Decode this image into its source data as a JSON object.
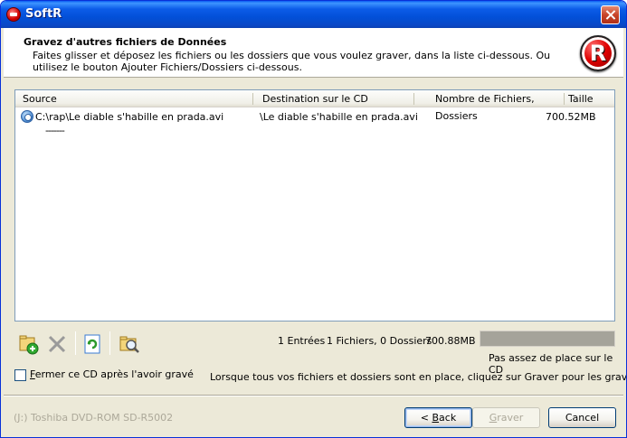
{
  "window": {
    "title": "SoftR"
  },
  "header": {
    "title": "Gravez d'autres fichiers de Données",
    "description": "Faites glisser et déposez les fichiers ou les dossiers que vous voulez graver, dans la liste ci-dessous. Ou utilisez le bouton Ajouter Fichiers/Dossiers ci-dessous.",
    "logo_letter": "R"
  },
  "list": {
    "columns": [
      "Source",
      "Destination sur le CD",
      "Nombre de Fichiers, Dossiers",
      "Taille"
    ],
    "rows": [
      {
        "source": "C:\\rap\\Le diable s'habille en prada.avi",
        "destination": "\\Le diable s'habille en prada.avi",
        "count": "",
        "size": "700.52MB"
      }
    ],
    "dash_row": "-------"
  },
  "toolbar": {
    "icons": [
      "add-files-icon",
      "delete-icon",
      "refresh-icon",
      "search-folder-icon"
    ]
  },
  "stats": {
    "entries": "1 Entrées",
    "files_folders": "1 Fichiers, 0 Dossiers",
    "total_size": "700.88MB",
    "capacity_warning": "Pas assez de place sur le CD",
    "capacity_fill": 1.0
  },
  "options": {
    "close_cd_label": "Fermer ce CD après l'avoir gravé",
    "close_cd_checked": false
  },
  "info": "Lorsque tous vos fichiers et dossiers sont en place, cliquez sur Graver pour les graver sur ce CD",
  "footer": {
    "drive": "(J:) Toshiba DVD-ROM SD-R5002",
    "back_label": "< Back",
    "burn_label": "Graver",
    "cancel_label": "Cancel"
  },
  "colors": {
    "titlebar": "#0250d8",
    "dialog_bg": "#ece9d8",
    "capacity_bar": "#a5a39a",
    "disabled_text": "#aca899"
  }
}
